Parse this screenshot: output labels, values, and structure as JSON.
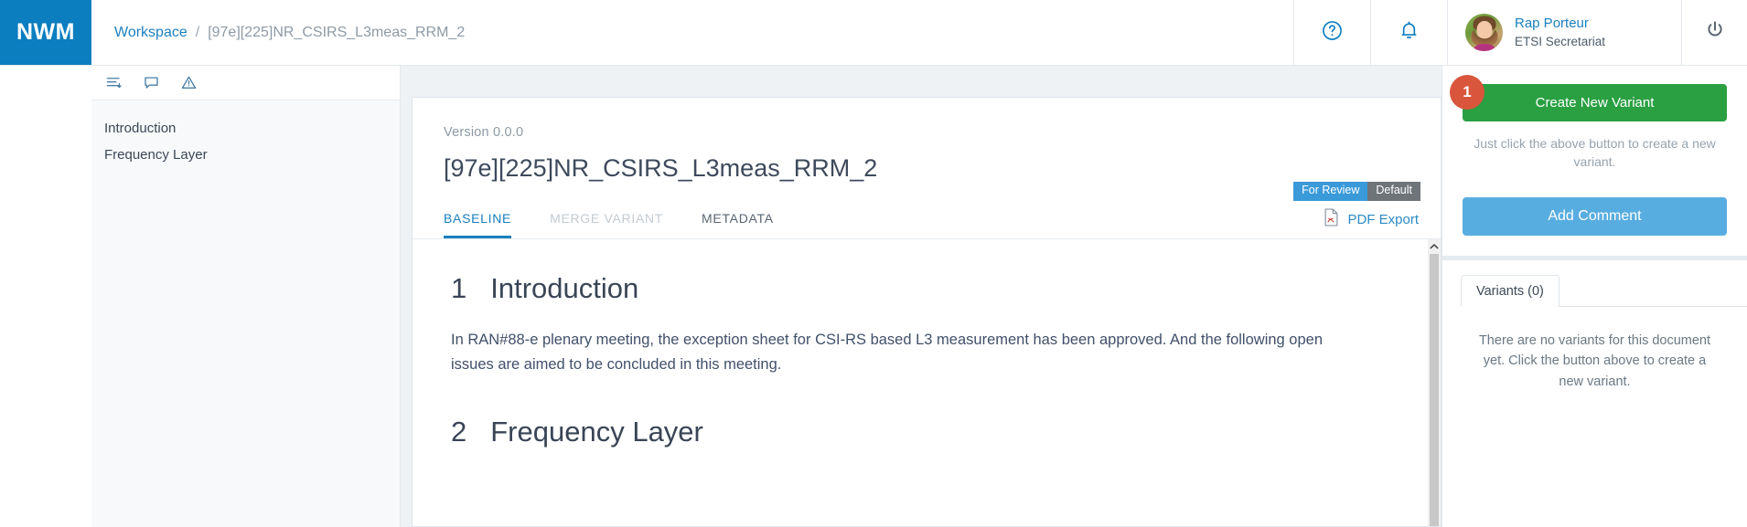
{
  "brand": {
    "logo_text": "NWM",
    "logo_bg": "#0b7ec0"
  },
  "breadcrumb": {
    "root": "Workspace",
    "separator": "/",
    "current": "[97e][225]NR_CSIRS_L3meas_RRM_2"
  },
  "topbar": {
    "help_icon": "help-circle-icon",
    "notifications_icon": "bell-icon",
    "logout_icon": "power-icon",
    "user": {
      "name": "Rap Porteur",
      "role": "ETSI Secretariat",
      "avatar": "user-avatar"
    }
  },
  "sidebar": {
    "toolbar_icons": [
      "outline-icon",
      "comment-icon",
      "warning-icon"
    ],
    "items": [
      {
        "label": "Introduction"
      },
      {
        "label": "Frequency Layer"
      }
    ]
  },
  "document": {
    "version": "Version 0.0.0",
    "title": "[97e][225]NR_CSIRS_L3meas_RRM_2",
    "badges": [
      {
        "label": "For Review",
        "color": "#3a9ad9"
      },
      {
        "label": "Default",
        "color": "#6f7479"
      }
    ],
    "tabs": [
      {
        "label": "BASELINE",
        "state": "active"
      },
      {
        "label": "MERGE VARIANT",
        "state": "disabled"
      },
      {
        "label": "METADATA",
        "state": "normal"
      }
    ],
    "pdf_export": {
      "label": "PDF Export",
      "icon": "pdf-file-icon"
    },
    "sections": [
      {
        "number": "1",
        "heading": "Introduction",
        "paragraph": "In RAN#88-e plenary meeting, the exception sheet for CSI-RS based L3 measurement has been approved. And the following open issues are aimed to be concluded in this meeting."
      },
      {
        "number": "2",
        "heading": "Frequency Layer",
        "paragraph": ""
      }
    ],
    "scroll_up_icon": "chevron-up-icon"
  },
  "right_panel": {
    "create_variant": {
      "label": "Create New Variant",
      "color": "#2aa043"
    },
    "step_badge": "1",
    "hint": "Just click the above button to create a new variant.",
    "add_comment": {
      "label": "Add Comment",
      "color": "#58ade0"
    },
    "tab": {
      "label": "Variants (0)"
    },
    "empty_message": "There are no variants for this document yet. Click the button above to create a new variant."
  }
}
